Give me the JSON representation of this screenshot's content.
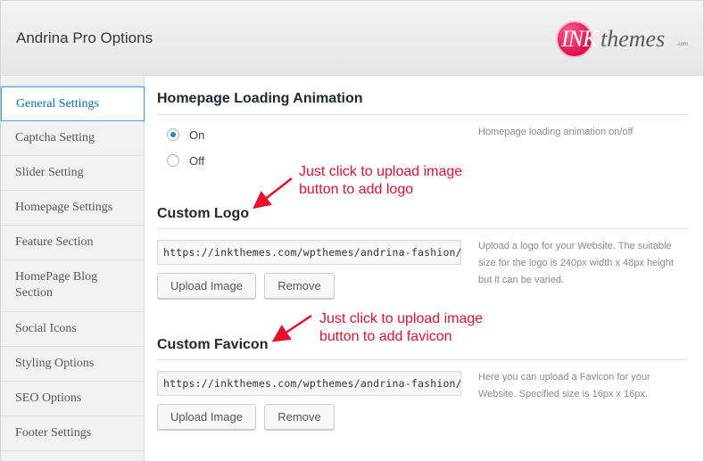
{
  "header": {
    "title": "Andrina Pro Options",
    "logo": {
      "ink": "INK",
      "themes": "themes",
      "com": ".com"
    }
  },
  "sidebar": {
    "items": [
      {
        "label": "General Settings",
        "active": true
      },
      {
        "label": "Captcha Setting"
      },
      {
        "label": "Slider Setting"
      },
      {
        "label": "Homepage Settings"
      },
      {
        "label": "Feature Section"
      },
      {
        "label": "HomePage Blog Section"
      },
      {
        "label": "Social Icons"
      },
      {
        "label": "Styling Options"
      },
      {
        "label": "SEO Options"
      },
      {
        "label": "Footer Settings"
      }
    ]
  },
  "main": {
    "loading": {
      "title": "Homepage Loading Animation",
      "on_label": "On",
      "off_label": "Off",
      "selected": "On",
      "helper": "Homepage loading animation on/off"
    },
    "logo": {
      "title": "Custom Logo",
      "url": "https://inkthemes.com/wpthemes/andrina-fashion/wp-",
      "upload_label": "Upload Image",
      "remove_label": "Remove",
      "helper": "Upload a logo for your Website. The suitable size for the logo is 240px width x 48px height but it can be varied."
    },
    "favicon": {
      "title": "Custom Favicon",
      "url": "https://inkthemes.com/wpthemes/andrina-fashion/wp-",
      "upload_label": "Upload Image",
      "remove_label": "Remove",
      "helper": "Here you can upload a Favicon for your Website. Specified size is 16px x 16px."
    }
  },
  "annotations": {
    "logo_note_line1": "Just click to upload image",
    "logo_note_line2": "button to add logo",
    "favicon_note_line1": "Just click to upload image",
    "favicon_note_line2": "button to add favicon"
  },
  "colors": {
    "accent": "#0073aa",
    "annotation": "#e8112d",
    "brand": "#e0104f"
  }
}
